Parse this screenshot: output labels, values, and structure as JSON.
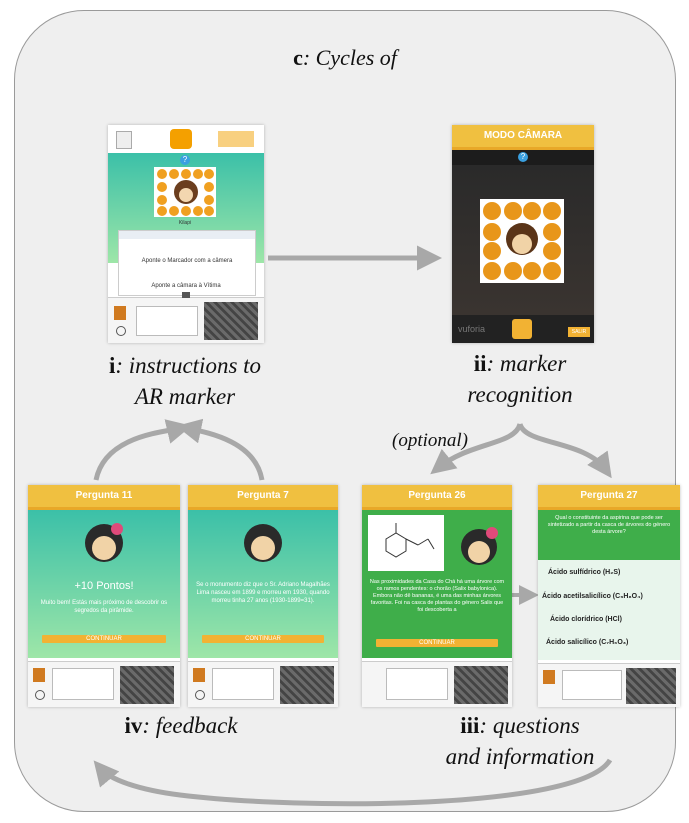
{
  "title": {
    "prefix": "c",
    "text": ": Cycles of"
  },
  "captions": {
    "i": {
      "num": "i",
      "line1": ": instructions to",
      "line2": "AR marker"
    },
    "ii": {
      "num": "ii",
      "line1": ": marker",
      "line2": "recognition"
    },
    "iii": {
      "num": "iii",
      "line1": ": questions",
      "line2": "and information"
    },
    "iv": {
      "num": "iv",
      "line1": ": feedback"
    },
    "optional": "(optional)"
  },
  "screens": {
    "s1": {
      "marker_name": "Kilapi",
      "instruction": "Aponte o Marcador com a câmera",
      "instruction2": "Aponte a câmara à Vítima",
      "help": "?"
    },
    "s2": {
      "header": "MODO CÂMARA",
      "brand": "vuforia",
      "help": "?",
      "corner": "SALIR"
    },
    "s3": {
      "header": "Pergunta 11",
      "points": "+10 Pontos!",
      "text": "Muito bem! Estás mais próximo de descobrir os segredos da pirâmide.",
      "button": "CONTINUAR"
    },
    "s4": {
      "header": "Pergunta 7",
      "text": "Se o monumento diz que o Sr. Adriano Magalhães Lima nasceu em 1899 e morreu em 1930, quando morreu tinha 27 anos (1930-1899=31).",
      "button": "CONTINUAR"
    },
    "s5": {
      "header": "Pergunta 26",
      "text": "Nas proximidades da Casa do Chá há uma árvore com os ramos pendentes: o chorão (Salix babylonica). Embora não dê bananas, é uma das minhas árvores favoritas. Foi na casca de plantas do género Salix que foi descoberta a",
      "button": "CONTINUAR"
    },
    "s6": {
      "header": "Pergunta 27",
      "question": "Qual o constituinte da aspirina que pode ser sintetizado a partir da casca de árvores do género desta árvore?",
      "options": [
        "Ácido sulfídrico (H₂S)",
        "Ácido acetilsalicílico (C₉H₈O₄)",
        "Ácido clorídrico (HCl)",
        "Ácido salicílico (C₇H₆O₃)"
      ]
    }
  },
  "colors": {
    "header": "#f0c040",
    "teal_top": "#3bc0a8",
    "green": "#3fae4a",
    "arrow": "#a8a8a8"
  },
  "icons": [
    "monkey-icon",
    "question-icon",
    "camera-icon",
    "arrow-icon",
    "sunflower-icon"
  ]
}
